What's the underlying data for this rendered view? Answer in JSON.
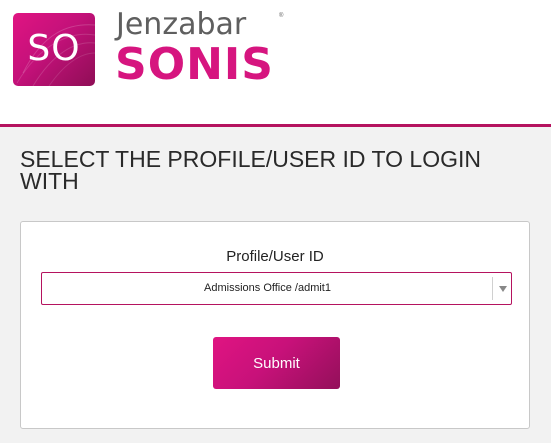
{
  "brand": {
    "logo_mark": "SO",
    "name_line1": "Jenzabar",
    "registered": "®",
    "name_line2": "SONIS",
    "colors": {
      "accent": "#d6157f",
      "accent_dark": "#b5135f",
      "wordmark_gray": "#5f5f5f"
    }
  },
  "page": {
    "title": "SELECT THE PROFILE/USER ID TO LOGIN WITH",
    "background": "#f2f2f2"
  },
  "form": {
    "profile_label": "Profile/User ID",
    "profile_selected": "Admissions Office /admit1",
    "dropdown_icon": "chevron-down-icon",
    "submit_label": "Submit"
  }
}
